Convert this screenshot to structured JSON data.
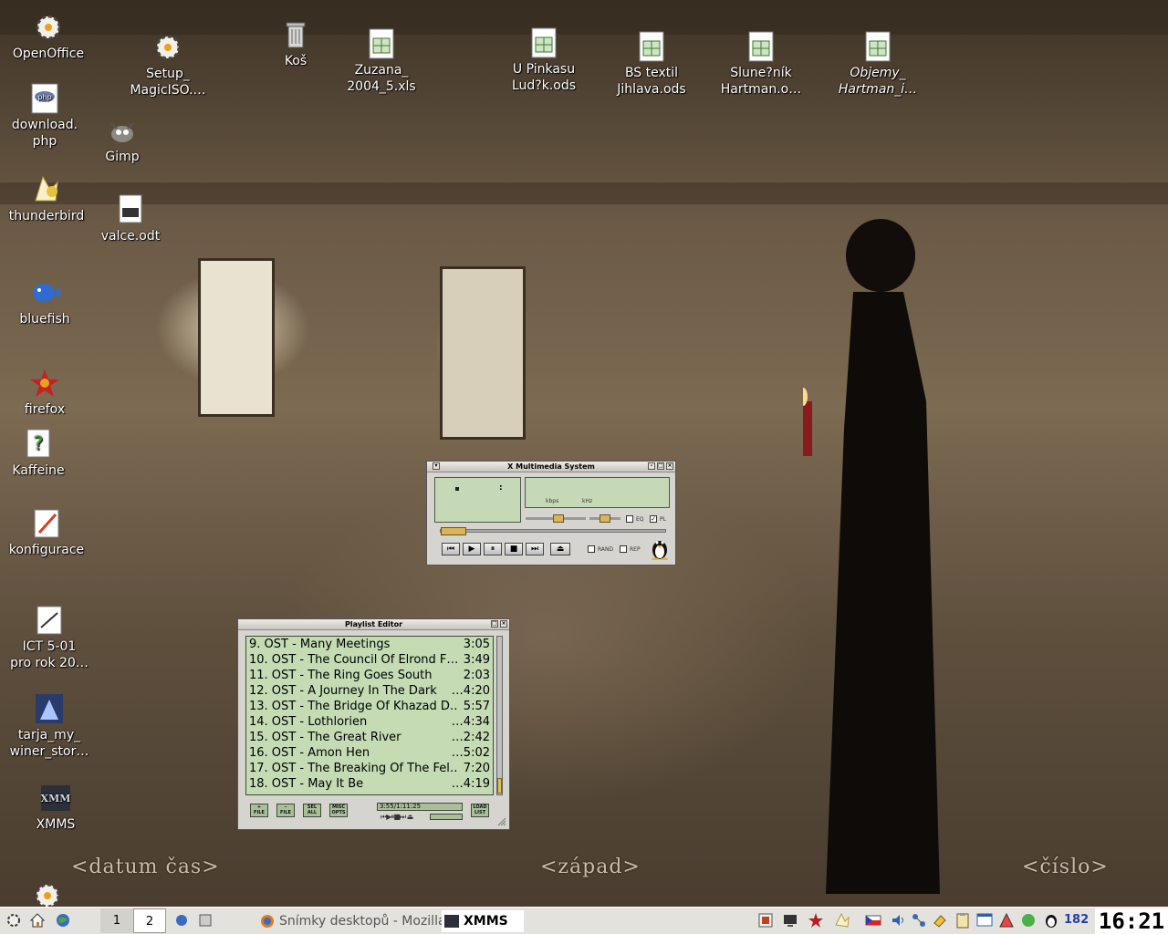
{
  "desktop": {
    "icons": [
      {
        "label": "OpenOffice",
        "icon": "openoffice-gear-icon"
      },
      {
        "label": "download.\nphp",
        "icon": "php-file-icon"
      },
      {
        "label": "thunderbird",
        "icon": "thunderbird-icon"
      },
      {
        "label": "bluefish",
        "icon": "bluefish-icon"
      },
      {
        "label": "firefox",
        "icon": "firefox-star-icon"
      },
      {
        "label": "Kaffeine",
        "icon": "kaffeine-icon"
      },
      {
        "label": "konfigurace",
        "icon": "config-icon"
      },
      {
        "label": "ICT 5-01\npro rok 20…",
        "icon": "document-icon"
      },
      {
        "label": "tarja_my_\nwiner_stor…",
        "icon": "image-thumbnail-icon"
      },
      {
        "label": "XMMS",
        "icon": "xmms-icon"
      },
      {
        "label": "Setup_\nMagicISO.…",
        "icon": "setup-gear-icon"
      },
      {
        "label": "Gimp",
        "icon": "gimp-icon"
      },
      {
        "label": "valce.odt",
        "icon": "writer-doc-icon"
      },
      {
        "label": "Koš",
        "icon": "trash-icon"
      },
      {
        "label": "Zuzana_\n2004_5.xls",
        "icon": "spreadsheet-icon"
      },
      {
        "label": "U Pinkasu\nLud?k.ods",
        "icon": "spreadsheet-icon"
      },
      {
        "label": "BS textil\nJihlava.ods",
        "icon": "spreadsheet-icon"
      },
      {
        "label": "Slune?ník\nHartman.o…",
        "icon": "spreadsheet-icon"
      },
      {
        "label": "Objemy_\nHartman_i…",
        "icon": "spreadsheet-icon"
      }
    ],
    "wallpaper_text": [
      "<datum čas>",
      "<západ>",
      "<číslo>"
    ]
  },
  "xmms_main": {
    "title": "X Multimedia System",
    "display_time": ":",
    "kbps_label": "kbps",
    "khz_label": "kHz",
    "eq_label": "EQ",
    "pl_label": "PL",
    "rand_label": "RAND",
    "rep_label": "REP",
    "buttons": [
      "previous",
      "play",
      "pause",
      "stop",
      "next",
      "eject"
    ],
    "pl_checked": true,
    "eq_checked": false,
    "volume": 0.55,
    "seek_position": 0.0
  },
  "playlist_editor": {
    "title": "Playlist Editor",
    "tracks": [
      {
        "title": "9. OST - Many Meetings",
        "duration": "3:05"
      },
      {
        "title": "10. OST - The Council Of Elrond F…",
        "duration": "3:49"
      },
      {
        "title": "11. OST - The Ring Goes South",
        "duration": "2:03"
      },
      {
        "title": "12. OST - A Journey In The Dark",
        "duration": "…4:20"
      },
      {
        "title": "13. OST - The Bridge Of Khazad D…",
        "duration": "5:57"
      },
      {
        "title": "14. OST - Lothlorien",
        "duration": "…4:34"
      },
      {
        "title": "15. OST - The Great River",
        "duration": "…2:42"
      },
      {
        "title": "16. OST - Amon Hen",
        "duration": "…5:02"
      },
      {
        "title": "17. OST - The Breaking Of The Fel…",
        "duration": "7:20"
      },
      {
        "title": "18. OST - May It Be",
        "duration": "…4:19"
      }
    ],
    "buttons": [
      {
        "top": "+",
        "bottom": "FILE"
      },
      {
        "top": "-",
        "bottom": "FILE"
      },
      {
        "top": "SEL",
        "bottom": "ALL"
      },
      {
        "top": "MISC",
        "bottom": "OPTS"
      },
      {
        "top": "LOAD",
        "bottom": "LIST"
      }
    ],
    "time_info": "3:55/1:11:25"
  },
  "taskbar": {
    "pager": [
      "1",
      "2"
    ],
    "tasks": [
      {
        "label": "Snímky desktopů - Mozilla",
        "icon": "firefox-icon"
      },
      {
        "label": "XMMS",
        "icon": "xmms-icon"
      }
    ],
    "tray_number": "182",
    "clock": "16:21"
  }
}
